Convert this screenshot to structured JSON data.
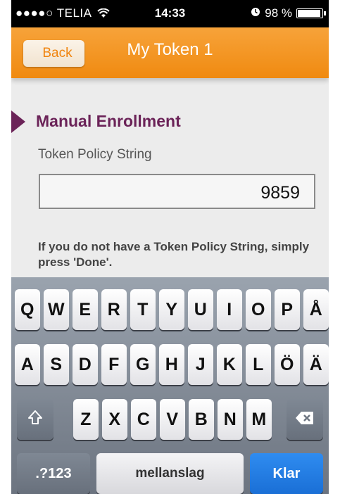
{
  "status_bar": {
    "carrier": "●●●●○ TELIA",
    "wifi_icon": "wifi-icon",
    "time": "14:33",
    "alarm_icon": "alarm-clock-icon",
    "battery": "98 %",
    "battery_level": 0.98
  },
  "nav": {
    "back_label": "Back",
    "title": "My Token 1"
  },
  "form": {
    "section_title": "Manual Enrollment",
    "field_label": "Token Policy String",
    "field_value": "9859",
    "hint": "If you do not have a Token Policy String, simply press 'Done'."
  },
  "keyboard": {
    "row1": [
      "Q",
      "W",
      "E",
      "R",
      "T",
      "Y",
      "U",
      "I",
      "O",
      "P",
      "Å"
    ],
    "row2": [
      "A",
      "S",
      "D",
      "F",
      "G",
      "H",
      "J",
      "K",
      "L",
      "Ö",
      "Ä"
    ],
    "row3": [
      "Z",
      "X",
      "C",
      "V",
      "B",
      "N",
      "M"
    ],
    "shift_icon": "shift-icon",
    "delete_icon": "delete-backspace-icon",
    "numbers_label": ".?123",
    "space_label": "mellanslag",
    "return_label": "Klar"
  }
}
